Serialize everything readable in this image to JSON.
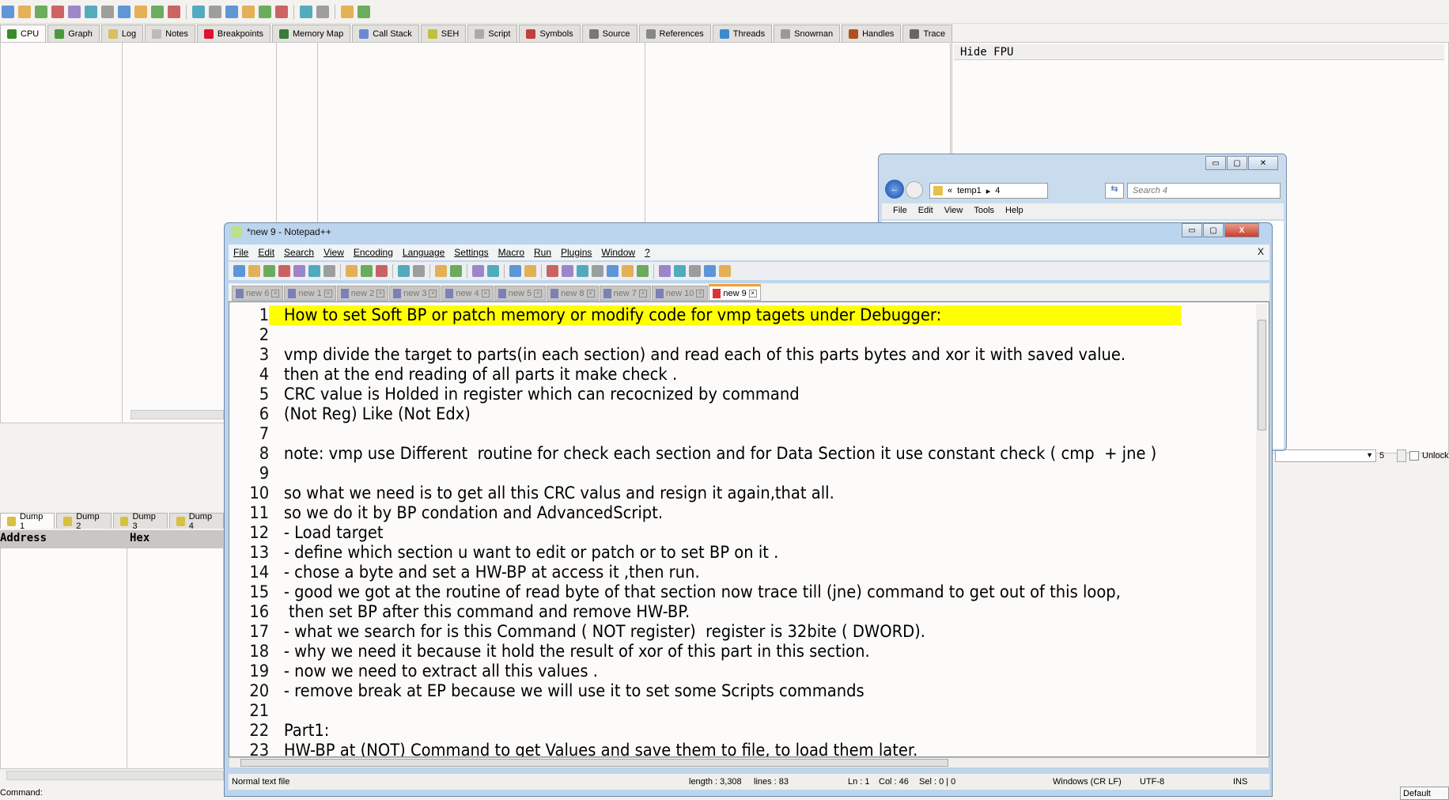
{
  "debugger": {
    "toolbar_icons": [
      "open-icon",
      "restart-icon",
      "stop-icon",
      "run-icon",
      "pause-icon",
      "step-into-icon",
      "step-over-icon",
      "trace-into-icon",
      "trace-over-icon",
      "execute-till-return-icon",
      "run-to-user-code-icon",
      "sep",
      "patch-icon",
      "comment-icon",
      "label-icon",
      "bookmark-icon",
      "function-icon",
      "hash-icon",
      "sep",
      "font-icon",
      "device-icon",
      "sep",
      "calculator-icon",
      "globe-icon"
    ],
    "tabs": [
      {
        "label": "CPU",
        "icon": "cpu-icon",
        "color": "#3a8a2a",
        "active": true
      },
      {
        "label": "Graph",
        "icon": "graph-icon",
        "color": "#4a9a3a"
      },
      {
        "label": "Log",
        "icon": "log-icon",
        "color": "#d8c060"
      },
      {
        "label": "Notes",
        "icon": "notes-icon",
        "color": "#bbbbbb"
      },
      {
        "label": "Breakpoints",
        "icon": "breakpoint-icon",
        "color": "#dd1133"
      },
      {
        "label": "Memory Map",
        "icon": "memory-map-icon",
        "color": "#3a7a3a"
      },
      {
        "label": "Call Stack",
        "icon": "call-stack-icon",
        "color": "#6a8ad0"
      },
      {
        "label": "SEH",
        "icon": "seh-icon",
        "color": "#c0c040"
      },
      {
        "label": "Script",
        "icon": "script-icon",
        "color": "#aaaaaa"
      },
      {
        "label": "Symbols",
        "icon": "symbols-icon",
        "color": "#c04040"
      },
      {
        "label": "Source",
        "icon": "source-icon",
        "color": "#777777"
      },
      {
        "label": "References",
        "icon": "references-icon",
        "color": "#888888"
      },
      {
        "label": "Threads",
        "icon": "threads-icon",
        "color": "#3a8ad0"
      },
      {
        "label": "Snowman",
        "icon": "snowman-icon",
        "color": "#999999"
      },
      {
        "label": "Handles",
        "icon": "handles-icon",
        "color": "#b05020"
      },
      {
        "label": "Trace",
        "icon": "trace-icon",
        "color": "#666666"
      }
    ],
    "hide_fpu": "Hide FPU",
    "dump_tabs": [
      "Dump 1",
      "Dump 2",
      "Dump 3",
      "Dump 4"
    ],
    "dump_headers": {
      "address": "Address",
      "hex": "Hex"
    },
    "command_label": "Command:",
    "default_label": "Default",
    "stack_spin_value": "5",
    "unlocked_label": "Unlocked"
  },
  "explorer": {
    "path": [
      "temp1",
      "4"
    ],
    "path_prefix": "«",
    "search_placeholder": "Search 4",
    "menu": [
      "File",
      "Edit",
      "View",
      "Tools",
      "Help"
    ]
  },
  "notepad": {
    "title": "*new 9 - Notepad++",
    "menu": [
      "File",
      "Edit",
      "Search",
      "View",
      "Encoding",
      "Language",
      "Settings",
      "Macro",
      "Run",
      "Plugins",
      "Window",
      "?"
    ],
    "close_doc": "X",
    "toolbar_icons": [
      "new-icon",
      "open-icon",
      "save-icon",
      "save-all-icon",
      "close-icon",
      "close-all-icon",
      "print-icon",
      "sep",
      "cut-icon",
      "copy-icon",
      "paste-icon",
      "sep",
      "undo-icon",
      "redo-icon",
      "sep",
      "find-icon",
      "replace-icon",
      "sep",
      "zoom-in-icon",
      "zoom-out-icon",
      "sep",
      "sync-v-icon",
      "sync-h-icon",
      "sep",
      "wrap-icon",
      "show-all-chars-icon",
      "indent-guide-icon",
      "doc-map-icon",
      "function-list-icon",
      "folder-icon",
      "monitor-icon",
      "sep",
      "record-macro-icon",
      "stop-record-icon",
      "play-macro-icon",
      "run-macro-multiple-icon",
      "save-macro-icon"
    ],
    "tabs": [
      {
        "label": "new 6"
      },
      {
        "label": "new 1"
      },
      {
        "label": "new 2"
      },
      {
        "label": "new 3"
      },
      {
        "label": "new 4"
      },
      {
        "label": "new 5"
      },
      {
        "label": "new 8"
      },
      {
        "label": "new 7"
      },
      {
        "label": "new 10"
      },
      {
        "label": "new 9",
        "active": true
      }
    ],
    "lines": [
      "How to set Soft BP or patch memory or modify code for vmp tagets under Debugger:",
      "",
      "vmp divide the target to parts(in each section) and read each of this parts bytes and xor it with saved value.",
      "then at the end reading of all parts it make check .",
      "CRC value is Holded in register which can recocnized by command",
      "(Not Reg) Like (Not Edx)",
      "",
      "note: vmp use Different  routine for check each section and for Data Section it use constant check ( cmp  + jne )",
      "",
      "so what we need is to get all this CRC valus and resign it again,that all.",
      "so we do it by BP condation and AdvancedScript.",
      "- Load target",
      "- define which section u want to edit or patch or to set BP on it .",
      "- chose a byte and set a HW-BP at access it ,then run.",
      "- good we got at the routine of read byte of that section now trace till (jne) command to get out of this loop,",
      " then set BP after this command and remove HW-BP.",
      "- what we search for is this Command ( NOT register)  register is 32bite ( DWORD).",
      "- why we need it because it hold the result of xor of this part in this section.",
      "- now we need to extract all this values .",
      "- remove break at EP because we will use it to set some Scripts commands",
      "",
      "Part1:",
      "HW-BP at (NOT) Command to get Values and save them to file, to load them later."
    ],
    "highlight_color": "#ffff00",
    "status": {
      "type": "Normal text file",
      "length": "length : 3,308",
      "lines": "lines : 83",
      "ln": "Ln : 1",
      "col": "Col : 46",
      "sel": "Sel : 0 | 0",
      "eol": "Windows (CR LF)",
      "encoding": "UTF-8",
      "mode": "INS"
    }
  }
}
